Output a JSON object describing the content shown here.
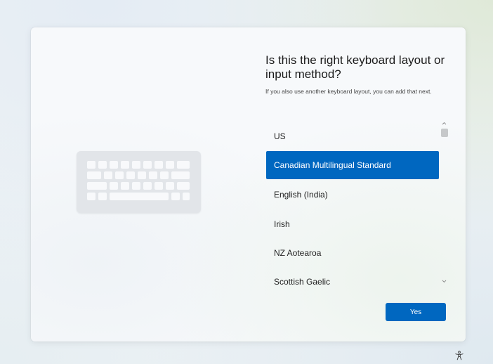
{
  "setup": {
    "title": "Is this the right keyboard layout or input method?",
    "subtitle": "If you also use another keyboard layout, you can add that next.",
    "layouts": [
      {
        "label": "US",
        "selected": false
      },
      {
        "label": "Canadian Multilingual Standard",
        "selected": true
      },
      {
        "label": "English (India)",
        "selected": false
      },
      {
        "label": "Irish",
        "selected": false
      },
      {
        "label": "NZ Aotearoa",
        "selected": false
      },
      {
        "label": "Scottish Gaelic",
        "selected": false
      }
    ],
    "yes_label": "Yes"
  },
  "icons": {
    "illustration": "keyboard-icon",
    "accessibility": "accessibility-icon",
    "scroll_up": "chevron-up-icon",
    "scroll_down": "chevron-down-icon"
  },
  "colors": {
    "accent": "#0067c0",
    "card": "#f7f9fb",
    "keyboard_body": "#e2e5e9",
    "key": "#f8f9fb"
  }
}
